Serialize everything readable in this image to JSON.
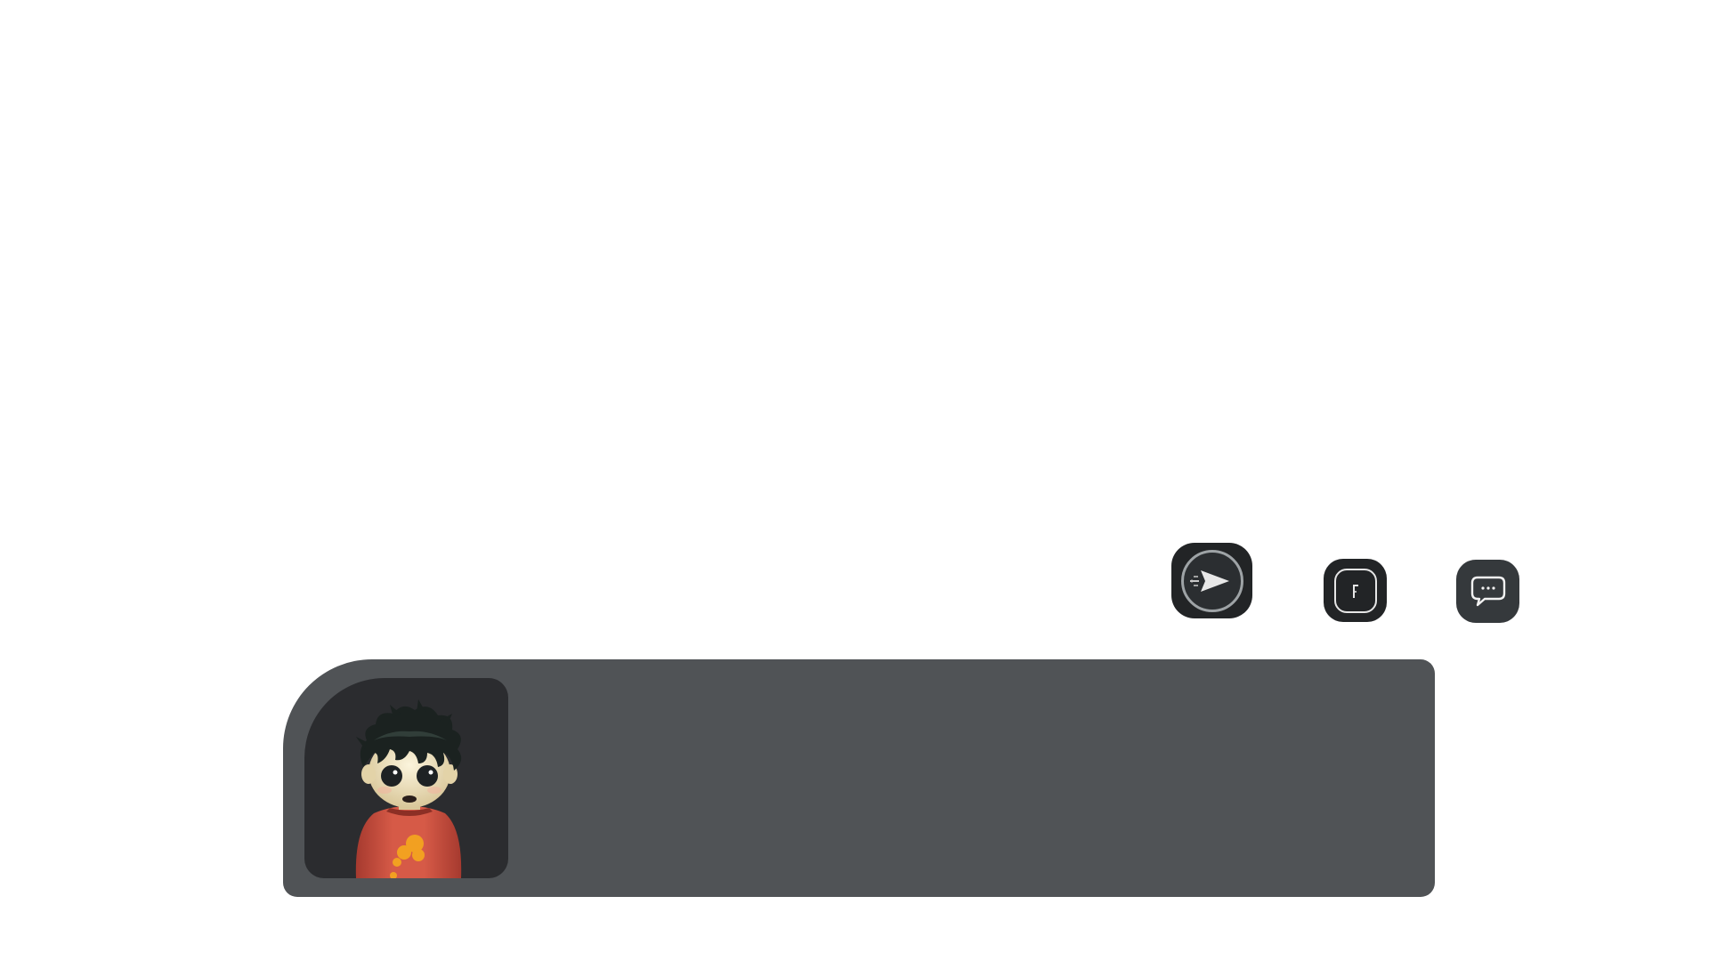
{
  "quick_actions": {
    "skip": {
      "icon": "skip-arrow-icon"
    },
    "log": {
      "icon": "log-book-icon"
    },
    "chat": {
      "icon": "speech-bubble-icon"
    }
  },
  "dialogue": {
    "speaker_name": "",
    "text": "",
    "portrait": {
      "icon": "character-portrait",
      "hair_color": "#1b2220",
      "skin_color": "#efe3c4",
      "shirt_color": "#c6483a",
      "emblem_color": "#f2a021"
    }
  },
  "colors": {
    "background": "#ffffff",
    "dialogue_panel": "#505356",
    "portrait_frame": "#2b2c2f",
    "button_dark": "#222426",
    "button_chat": "#35393c"
  }
}
